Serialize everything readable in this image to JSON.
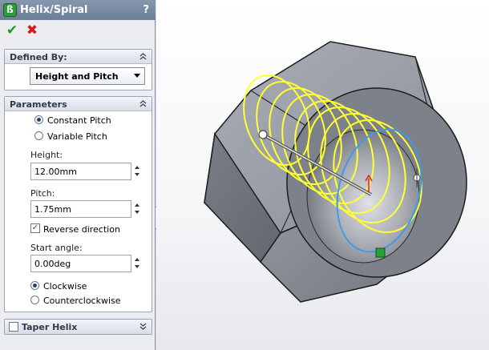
{
  "window": {
    "title": "Helix/Spiral",
    "help": "?"
  },
  "actions": {
    "ok": "✔",
    "cancel": "✖"
  },
  "defined_by": {
    "header": "Defined By:",
    "selected": "Height and Pitch"
  },
  "parameters": {
    "header": "Parameters",
    "pitch_options": [
      {
        "label": "Constant Pitch",
        "selected": true
      },
      {
        "label": "Variable Pitch",
        "selected": false
      }
    ],
    "height": {
      "label": "Height:",
      "value": "12.00mm"
    },
    "pitch": {
      "label": "Pitch:",
      "value": "1.75mm"
    },
    "reverse_direction": {
      "label": "Reverse direction",
      "checked": true
    },
    "start_angle": {
      "label": "Start angle:",
      "value": "0.00deg"
    },
    "direction_options": [
      {
        "label": "Clockwise",
        "selected": true
      },
      {
        "label": "Counterclockwise",
        "selected": false
      }
    ]
  },
  "taper_helix": {
    "header": "Taper Helix",
    "checked": false
  },
  "colors": {
    "titlebar": "#7385a2",
    "helix": "#ffff33",
    "edge_selection": "#3d9be9",
    "nut_face": "#8c9099"
  }
}
